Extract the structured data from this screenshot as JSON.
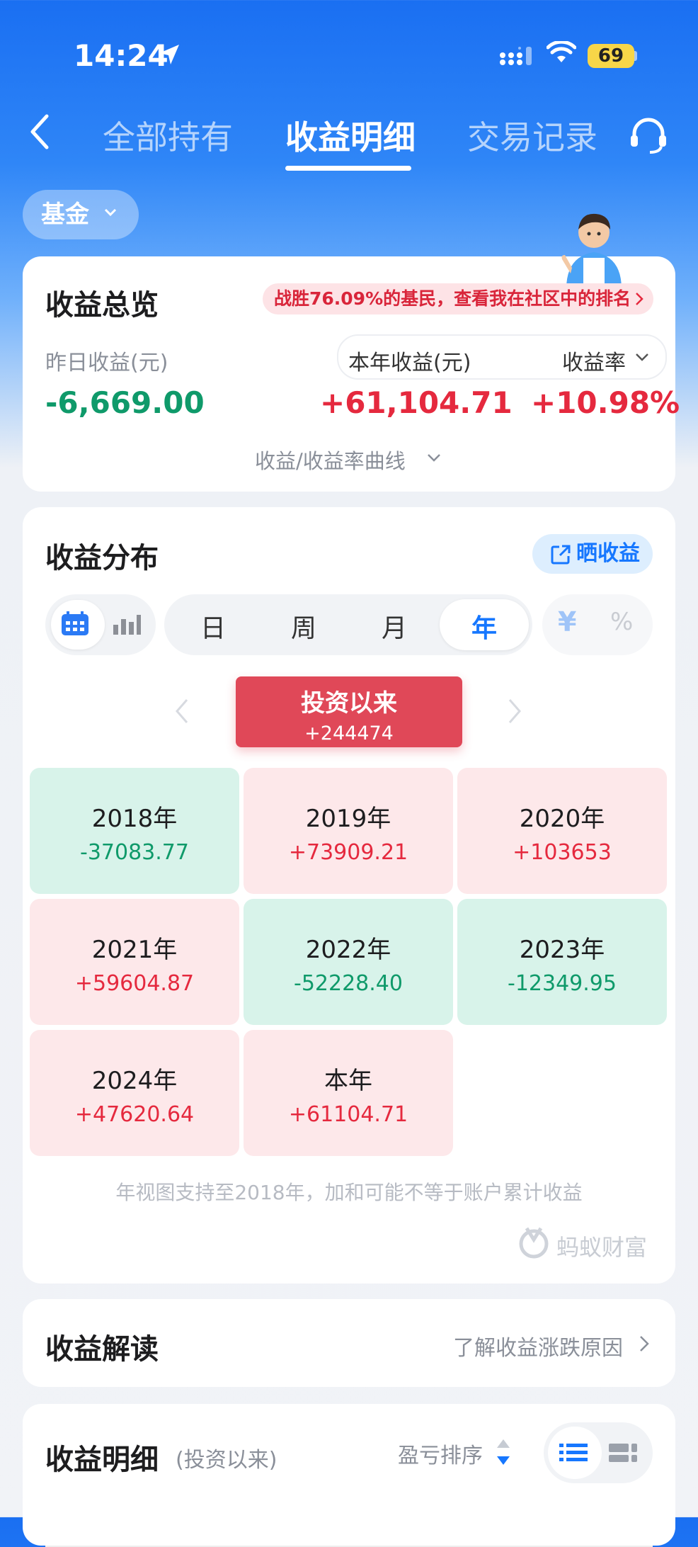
{
  "status": {
    "time": "14:24",
    "battery": "69"
  },
  "nav": {
    "tabs": [
      {
        "label": "全部持有"
      },
      {
        "label": "收益明细"
      },
      {
        "label": "交易记录"
      }
    ],
    "active_tab": "收益明细"
  },
  "filter": {
    "label": "基金"
  },
  "overview": {
    "title": "收益总览",
    "rank_text": "战胜76.09%的基民，查看我在社区中的排名",
    "yesterday_label": "昨日收益(元)",
    "yesterday_value": "-6,669.00",
    "year_label": "本年收益(元)",
    "rate_label": "收益率",
    "year_value": "+61,104.71",
    "rate_value": "+10.98%",
    "curve_link": "收益/收益率曲线"
  },
  "distribution": {
    "title": "收益分布",
    "share_label": "晒收益",
    "periods": [
      "日",
      "周",
      "月",
      "年"
    ],
    "active_period": "年",
    "units": [
      "¥",
      "%"
    ],
    "hero_title": "投资以来",
    "hero_value": "+244474",
    "years": [
      {
        "year": "2018年",
        "value": "-37083.77",
        "sign": "neg"
      },
      {
        "year": "2019年",
        "value": "+73909.21",
        "sign": "pos"
      },
      {
        "year": "2020年",
        "value": "+103653",
        "sign": "pos"
      },
      {
        "year": "2021年",
        "value": "+59604.87",
        "sign": "pos"
      },
      {
        "year": "2022年",
        "value": "-52228.40",
        "sign": "neg"
      },
      {
        "year": "2023年",
        "value": "-12349.95",
        "sign": "neg"
      },
      {
        "year": "2024年",
        "value": "+47620.64",
        "sign": "pos"
      },
      {
        "year": "本年",
        "value": "+61104.71",
        "sign": "pos"
      }
    ],
    "note": "年视图支持至2018年，加和可能不等于账户累计收益",
    "brand": "蚂蚁财富"
  },
  "interpret": {
    "title": "收益解读",
    "link": "了解收益涨跌原因"
  },
  "detail": {
    "title": "收益明细",
    "subtitle": "(投资以来)",
    "sort_label": "盈亏排序"
  },
  "colors": {
    "positive": "#e5293e",
    "negative": "#0f9a6a",
    "accent": "#1677ff",
    "hero": "#e04858"
  }
}
